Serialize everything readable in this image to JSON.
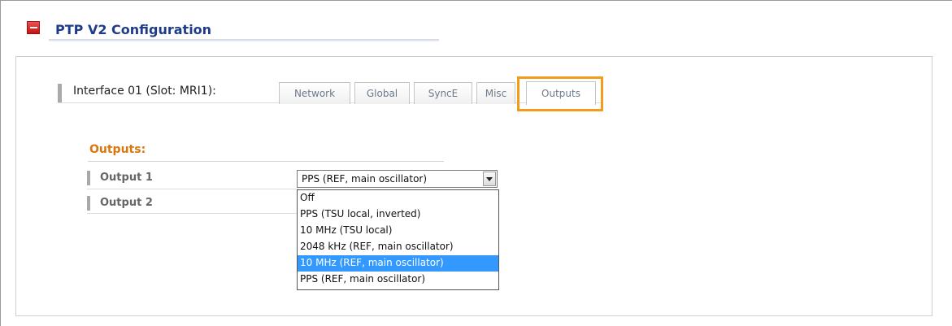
{
  "section": {
    "title": "PTP V2 Configuration"
  },
  "interface": {
    "label": "Interface 01 (Slot: MRI1):"
  },
  "tabs": [
    {
      "label": "Network"
    },
    {
      "label": "Global"
    },
    {
      "label": "SyncE"
    },
    {
      "label": "Misc"
    },
    {
      "label": "Outputs",
      "active": true
    }
  ],
  "outputs": {
    "title": "Outputs:",
    "rows": [
      {
        "label": "Output 1",
        "selected_value": "PPS (REF, main oscillator)"
      },
      {
        "label": "Output 2"
      }
    ],
    "dropdown_options": [
      "Off",
      "PPS (TSU local, inverted)",
      "10 MHz (TSU local)",
      "2048 kHz (REF, main oscillator)",
      "10 MHz (REF, main oscillator)",
      "PPS (REF, main oscillator)"
    ],
    "highlighted_option": "10 MHz (REF, main oscillator)"
  },
  "colors": {
    "title_blue": "#1e3c8a",
    "accent_orange": "#f29c1c",
    "section_orange": "#d9770f",
    "selection_blue": "#3399ff",
    "collapse_red": "#e02020"
  },
  "icons": {
    "collapse": "minus-box-icon",
    "select_arrow": "chevron-down-icon"
  }
}
